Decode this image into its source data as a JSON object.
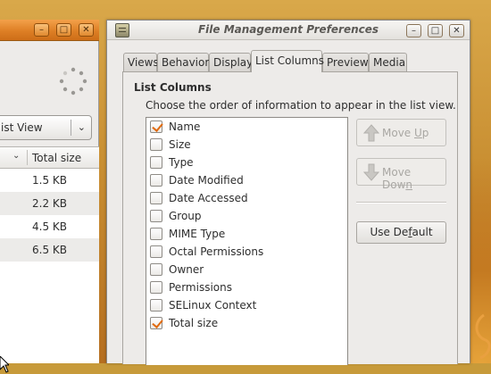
{
  "bg_window": {
    "view_combo_label": "ist View",
    "column_header": "Total size",
    "rows": [
      "1.5 KB",
      "2.2 KB",
      "4.5 KB",
      "6.5 KB"
    ]
  },
  "dialog": {
    "title": "File Management Preferences",
    "tabs": [
      {
        "label": "Views",
        "active": false
      },
      {
        "label": "Behavior",
        "active": false
      },
      {
        "label": "Display",
        "active": false
      },
      {
        "label": "List Columns",
        "active": true
      },
      {
        "label": "Preview",
        "active": false
      },
      {
        "label": "Media",
        "active": false
      }
    ],
    "section_title": "List Columns",
    "instructions": "Choose the order of information to appear in the list view.",
    "columns": [
      {
        "label": "Name",
        "checked": true
      },
      {
        "label": "Size",
        "checked": false
      },
      {
        "label": "Type",
        "checked": false
      },
      {
        "label": "Date Modified",
        "checked": false
      },
      {
        "label": "Date Accessed",
        "checked": false
      },
      {
        "label": "Group",
        "checked": false
      },
      {
        "label": "MIME Type",
        "checked": false
      },
      {
        "label": "Octal Permissions",
        "checked": false
      },
      {
        "label": "Owner",
        "checked": false
      },
      {
        "label": "Permissions",
        "checked": false
      },
      {
        "label": "SELinux Context",
        "checked": false
      },
      {
        "label": "Total size",
        "checked": true
      }
    ],
    "buttons": {
      "move_up_pre": "Move ",
      "move_up_mnemonic": "U",
      "move_up_post": "p",
      "move_down_pre": "Move Dow",
      "move_down_mnemonic": "n",
      "move_down_post": "",
      "use_default_pre": "Use De",
      "use_default_mnemonic": "f",
      "use_default_post": "ault"
    }
  },
  "colors": {
    "accent": "#e16b10",
    "titlebar_active": "#de7f25"
  }
}
